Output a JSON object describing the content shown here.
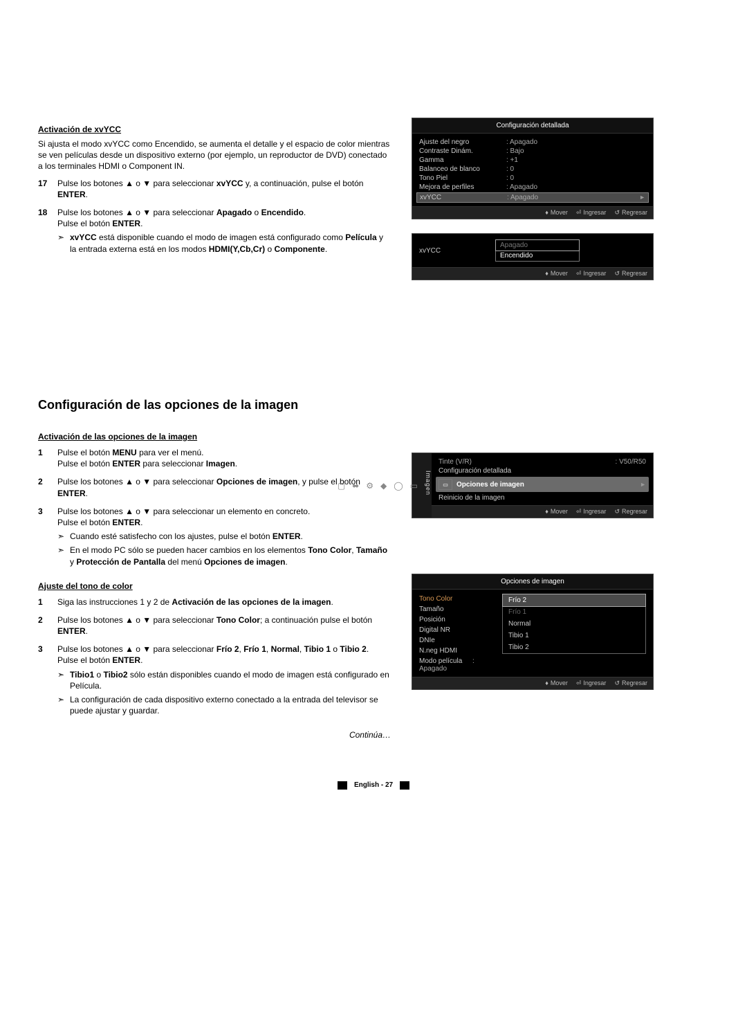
{
  "section1": {
    "heading": "Activación de xvYCC",
    "intro": "Si ajusta el modo xvYCC como Encendido, se aumenta el detalle y el espacio de color mientras se ven películas desde un dispositivo externo (por ejemplo, un reproductor de DVD) conectado a los terminales HDMI o Component IN.",
    "step17_num": "17",
    "step17_a": "Pulse los botones ▲ o ▼ para seleccionar ",
    "step17_b": "xvYCC",
    "step17_c": " y, a continuación, pulse el botón ",
    "step17_d": "ENTER",
    "step17_e": ".",
    "step18_num": "18",
    "step18_a": "Pulse los botones ▲ o ▼ para seleccionar ",
    "step18_b": "Apagado",
    "step18_c": " o ",
    "step18_d": "Encendido",
    "step18_e": ".",
    "step18_line2a": "Pulse el botón ",
    "step18_line2b": "ENTER",
    "step18_line2c": ".",
    "step18_note1a": "xvYCC",
    "step18_note1b": " está disponible cuando el modo de imagen está configurado como ",
    "step18_note1c": "Película",
    "step18_note1d": " y la entrada externa está en los modos ",
    "step18_note1e": "HDMI(Y,Cb,Cr)",
    "step18_note1f": " o ",
    "step18_note1g": "Componente",
    "step18_note1h": "."
  },
  "section2": {
    "title": "Configuración de las opciones de la imagen",
    "sub1": "Activación de las opciones de la imagen",
    "s1_1_num": "1",
    "s1_1_a": "Pulse el botón ",
    "s1_1_b": "MENU",
    "s1_1_c": " para ver el menú.",
    "s1_1_line2a": "Pulse el botón ",
    "s1_1_line2b": "ENTER",
    "s1_1_line2c": " para seleccionar ",
    "s1_1_line2d": "Imagen",
    "s1_1_line2e": ".",
    "s1_2_num": "2",
    "s1_2_a": "Pulse los botones ▲ o ▼ para seleccionar ",
    "s1_2_b": "Opciones de imagen",
    "s1_2_c": ", y pulse el botón ",
    "s1_2_d": "ENTER",
    "s1_2_e": ".",
    "s1_3_num": "3",
    "s1_3_a": "Pulse los botones ▲ o ▼ para seleccionar un elemento en concreto.",
    "s1_3_line2a": "Pulse el botón ",
    "s1_3_line2b": "ENTER",
    "s1_3_line2c": ".",
    "s1_3_note1a": "Cuando esté satisfecho con los ajustes, pulse el botón ",
    "s1_3_note1b": "ENTER",
    "s1_3_note1c": ".",
    "s1_3_note2a": "En el modo PC sólo se pueden hacer cambios en los elementos ",
    "s1_3_note2b": "Tono Color",
    "s1_3_note2c": ", ",
    "s1_3_note2d": "Tamaño",
    "s1_3_note2e": " y ",
    "s1_3_note2f": "Protección de Pantalla",
    "s1_3_note2g": " del menú ",
    "s1_3_note2h": "Opciones de imagen",
    "s1_3_note2i": ".",
    "sub2": "Ajuste del tono de color",
    "s2_1_num": "1",
    "s2_1_a": "Siga las instrucciones 1 y 2 de ",
    "s2_1_b": "Activación de las opciones de la imagen",
    "s2_1_c": ".",
    "s2_2_num": "2",
    "s2_2_a": "Pulse los botones ▲ o ▼ para seleccionar ",
    "s2_2_b": "Tono Color",
    "s2_2_c": "; a continuación pulse el botón ",
    "s2_2_d": "ENTER",
    "s2_2_e": ".",
    "s2_3_num": "3",
    "s2_3_a": "Pulse los botones ▲ o ▼ para seleccionar ",
    "s2_3_b": "Frío 2",
    "s2_3_c": ", ",
    "s2_3_d": "Frío 1",
    "s2_3_e": ", ",
    "s2_3_f": "Normal",
    "s2_3_g": ", ",
    "s2_3_h": "Tibio 1",
    "s2_3_i": " o ",
    "s2_3_j": "Tibio 2",
    "s2_3_k": ".",
    "s2_3_line2a": "Pulse el botón ",
    "s2_3_line2b": "ENTER",
    "s2_3_line2c": ".",
    "s2_3_note1a": "Tibio1",
    "s2_3_note1b": " o ",
    "s2_3_note1c": "Tibio2",
    "s2_3_note1d": " sólo están disponibles cuando el modo de imagen está configurado en Película.",
    "s2_3_note2": "La configuración de cada dispositivo externo conectado a la entrada del televisor se puede ajustar y guardar.",
    "continua": "Continúa…"
  },
  "osd1": {
    "title": "Configuración detallada",
    "rows": [
      {
        "label": "Ajuste del negro",
        "val": ": Apagado"
      },
      {
        "label": "Contraste Dinám.",
        "val": ": Bajo"
      },
      {
        "label": "Gamma",
        "val": ": +1"
      },
      {
        "label": "Balanceo de blanco",
        "val": ": 0"
      },
      {
        "label": "Tono Piel",
        "val": ": 0"
      },
      {
        "label": "Mejora de perfiles",
        "val": ": Apagado"
      }
    ],
    "hl": {
      "label": "xvYCC",
      "val": ": Apagado"
    }
  },
  "osd2": {
    "label": "xvYCC",
    "opt1": "Apagado",
    "opt2": "Encendido"
  },
  "osd3": {
    "vlabel": "Imagen",
    "tinte_l": "Tinte (V/R)",
    "tinte_v": ": V50/R50",
    "row_conf": "Configuración detallada",
    "row_sel": "Opciones de imagen",
    "row_reset": "Reinicio de la imagen"
  },
  "osd4": {
    "title": "Opciones de imagen",
    "left": [
      "Tono Color",
      "Tamaño",
      "Posición",
      "Digital NR",
      "DNIe",
      "N.neg HDMI",
      "Modo película"
    ],
    "modo_val": ": Apagado",
    "right": [
      "Frío 2",
      "Frío 1",
      "Normal",
      "Tibio 1",
      "Tibio 2"
    ]
  },
  "foot": {
    "mover": "Mover",
    "ingresar": "Ingresar",
    "regresar": "Regresar"
  },
  "pagefoot": "English - 27"
}
